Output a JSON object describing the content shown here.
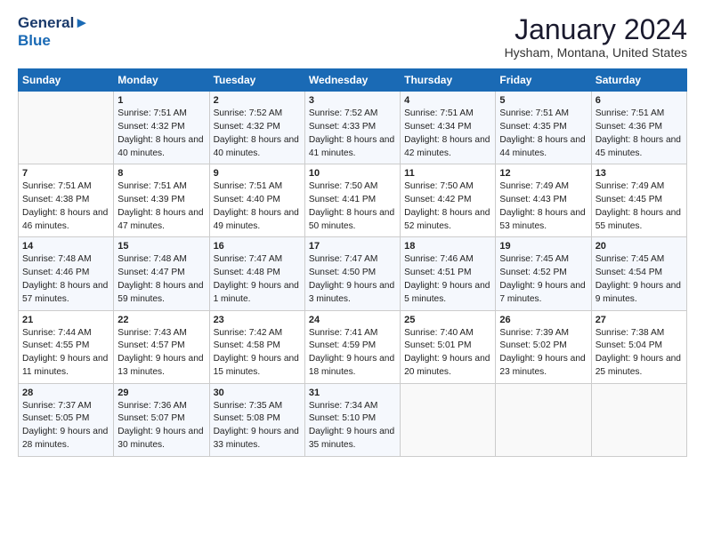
{
  "header": {
    "logo_line1": "General",
    "logo_line2": "Blue",
    "main_title": "January 2024",
    "subtitle": "Hysham, Montana, United States"
  },
  "calendar": {
    "days_of_week": [
      "Sunday",
      "Monday",
      "Tuesday",
      "Wednesday",
      "Thursday",
      "Friday",
      "Saturday"
    ],
    "weeks": [
      [
        {
          "day": "",
          "sunrise": "",
          "sunset": "",
          "daylight": ""
        },
        {
          "day": "1",
          "sunrise": "Sunrise: 7:51 AM",
          "sunset": "Sunset: 4:32 PM",
          "daylight": "Daylight: 8 hours and 40 minutes."
        },
        {
          "day": "2",
          "sunrise": "Sunrise: 7:52 AM",
          "sunset": "Sunset: 4:32 PM",
          "daylight": "Daylight: 8 hours and 40 minutes."
        },
        {
          "day": "3",
          "sunrise": "Sunrise: 7:52 AM",
          "sunset": "Sunset: 4:33 PM",
          "daylight": "Daylight: 8 hours and 41 minutes."
        },
        {
          "day": "4",
          "sunrise": "Sunrise: 7:51 AM",
          "sunset": "Sunset: 4:34 PM",
          "daylight": "Daylight: 8 hours and 42 minutes."
        },
        {
          "day": "5",
          "sunrise": "Sunrise: 7:51 AM",
          "sunset": "Sunset: 4:35 PM",
          "daylight": "Daylight: 8 hours and 44 minutes."
        },
        {
          "day": "6",
          "sunrise": "Sunrise: 7:51 AM",
          "sunset": "Sunset: 4:36 PM",
          "daylight": "Daylight: 8 hours and 45 minutes."
        }
      ],
      [
        {
          "day": "7",
          "sunrise": "Sunrise: 7:51 AM",
          "sunset": "Sunset: 4:38 PM",
          "daylight": "Daylight: 8 hours and 46 minutes."
        },
        {
          "day": "8",
          "sunrise": "Sunrise: 7:51 AM",
          "sunset": "Sunset: 4:39 PM",
          "daylight": "Daylight: 8 hours and 47 minutes."
        },
        {
          "day": "9",
          "sunrise": "Sunrise: 7:51 AM",
          "sunset": "Sunset: 4:40 PM",
          "daylight": "Daylight: 8 hours and 49 minutes."
        },
        {
          "day": "10",
          "sunrise": "Sunrise: 7:50 AM",
          "sunset": "Sunset: 4:41 PM",
          "daylight": "Daylight: 8 hours and 50 minutes."
        },
        {
          "day": "11",
          "sunrise": "Sunrise: 7:50 AM",
          "sunset": "Sunset: 4:42 PM",
          "daylight": "Daylight: 8 hours and 52 minutes."
        },
        {
          "day": "12",
          "sunrise": "Sunrise: 7:49 AM",
          "sunset": "Sunset: 4:43 PM",
          "daylight": "Daylight: 8 hours and 53 minutes."
        },
        {
          "day": "13",
          "sunrise": "Sunrise: 7:49 AM",
          "sunset": "Sunset: 4:45 PM",
          "daylight": "Daylight: 8 hours and 55 minutes."
        }
      ],
      [
        {
          "day": "14",
          "sunrise": "Sunrise: 7:48 AM",
          "sunset": "Sunset: 4:46 PM",
          "daylight": "Daylight: 8 hours and 57 minutes."
        },
        {
          "day": "15",
          "sunrise": "Sunrise: 7:48 AM",
          "sunset": "Sunset: 4:47 PM",
          "daylight": "Daylight: 8 hours and 59 minutes."
        },
        {
          "day": "16",
          "sunrise": "Sunrise: 7:47 AM",
          "sunset": "Sunset: 4:48 PM",
          "daylight": "Daylight: 9 hours and 1 minute."
        },
        {
          "day": "17",
          "sunrise": "Sunrise: 7:47 AM",
          "sunset": "Sunset: 4:50 PM",
          "daylight": "Daylight: 9 hours and 3 minutes."
        },
        {
          "day": "18",
          "sunrise": "Sunrise: 7:46 AM",
          "sunset": "Sunset: 4:51 PM",
          "daylight": "Daylight: 9 hours and 5 minutes."
        },
        {
          "day": "19",
          "sunrise": "Sunrise: 7:45 AM",
          "sunset": "Sunset: 4:52 PM",
          "daylight": "Daylight: 9 hours and 7 minutes."
        },
        {
          "day": "20",
          "sunrise": "Sunrise: 7:45 AM",
          "sunset": "Sunset: 4:54 PM",
          "daylight": "Daylight: 9 hours and 9 minutes."
        }
      ],
      [
        {
          "day": "21",
          "sunrise": "Sunrise: 7:44 AM",
          "sunset": "Sunset: 4:55 PM",
          "daylight": "Daylight: 9 hours and 11 minutes."
        },
        {
          "day": "22",
          "sunrise": "Sunrise: 7:43 AM",
          "sunset": "Sunset: 4:57 PM",
          "daylight": "Daylight: 9 hours and 13 minutes."
        },
        {
          "day": "23",
          "sunrise": "Sunrise: 7:42 AM",
          "sunset": "Sunset: 4:58 PM",
          "daylight": "Daylight: 9 hours and 15 minutes."
        },
        {
          "day": "24",
          "sunrise": "Sunrise: 7:41 AM",
          "sunset": "Sunset: 4:59 PM",
          "daylight": "Daylight: 9 hours and 18 minutes."
        },
        {
          "day": "25",
          "sunrise": "Sunrise: 7:40 AM",
          "sunset": "Sunset: 5:01 PM",
          "daylight": "Daylight: 9 hours and 20 minutes."
        },
        {
          "day": "26",
          "sunrise": "Sunrise: 7:39 AM",
          "sunset": "Sunset: 5:02 PM",
          "daylight": "Daylight: 9 hours and 23 minutes."
        },
        {
          "day": "27",
          "sunrise": "Sunrise: 7:38 AM",
          "sunset": "Sunset: 5:04 PM",
          "daylight": "Daylight: 9 hours and 25 minutes."
        }
      ],
      [
        {
          "day": "28",
          "sunrise": "Sunrise: 7:37 AM",
          "sunset": "Sunset: 5:05 PM",
          "daylight": "Daylight: 9 hours and 28 minutes."
        },
        {
          "day": "29",
          "sunrise": "Sunrise: 7:36 AM",
          "sunset": "Sunset: 5:07 PM",
          "daylight": "Daylight: 9 hours and 30 minutes."
        },
        {
          "day": "30",
          "sunrise": "Sunrise: 7:35 AM",
          "sunset": "Sunset: 5:08 PM",
          "daylight": "Daylight: 9 hours and 33 minutes."
        },
        {
          "day": "31",
          "sunrise": "Sunrise: 7:34 AM",
          "sunset": "Sunset: 5:10 PM",
          "daylight": "Daylight: 9 hours and 35 minutes."
        },
        {
          "day": "",
          "sunrise": "",
          "sunset": "",
          "daylight": ""
        },
        {
          "day": "",
          "sunrise": "",
          "sunset": "",
          "daylight": ""
        },
        {
          "day": "",
          "sunrise": "",
          "sunset": "",
          "daylight": ""
        }
      ]
    ]
  }
}
